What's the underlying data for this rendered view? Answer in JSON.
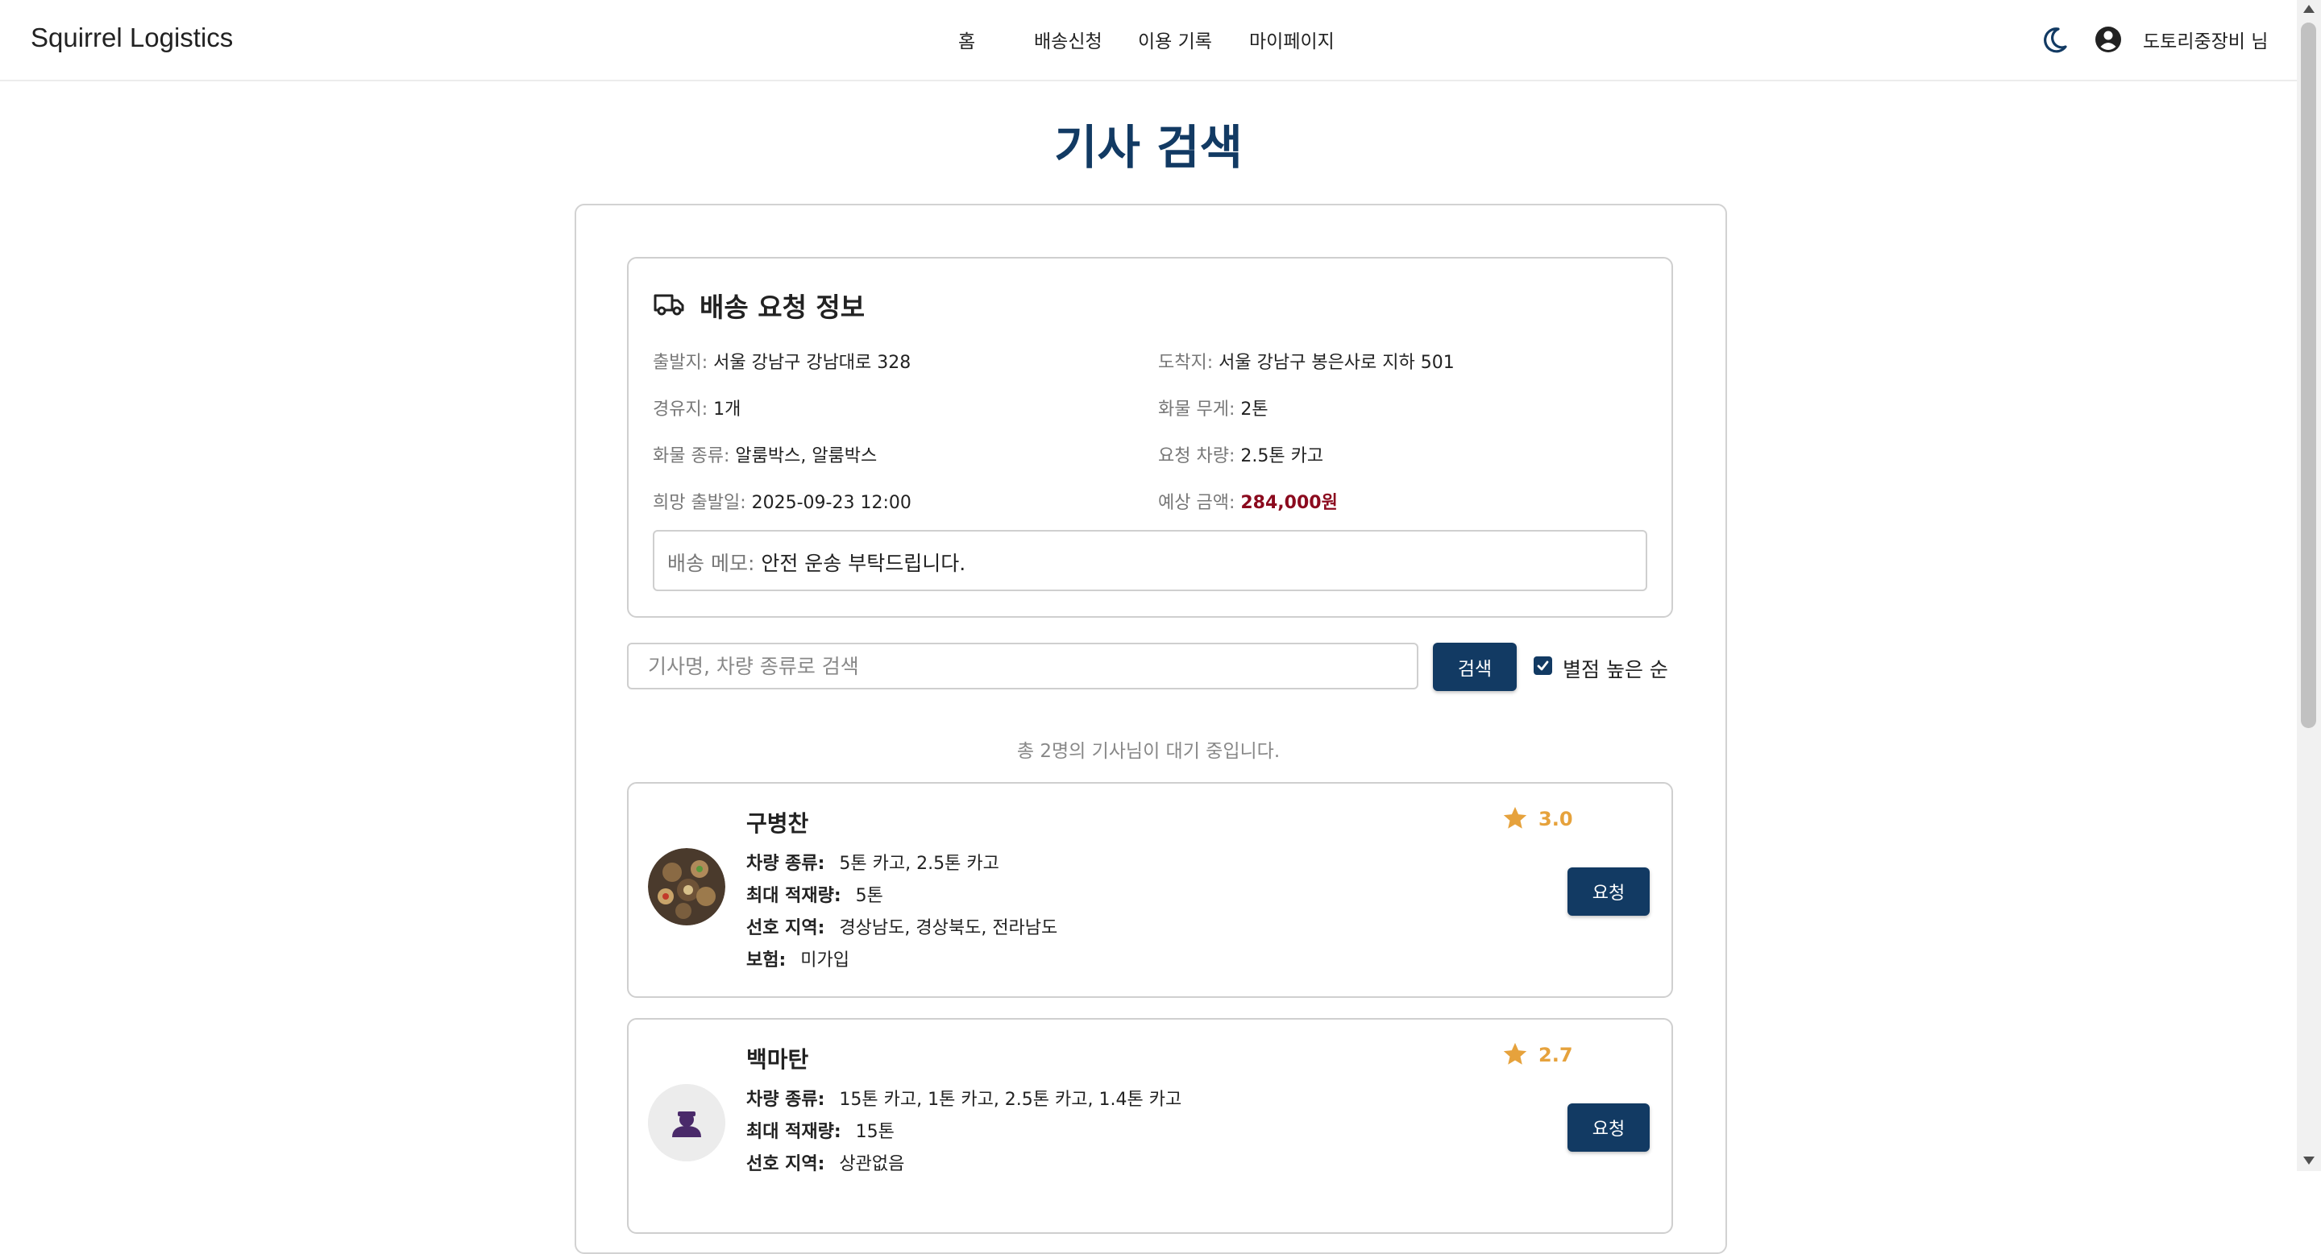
{
  "header": {
    "brand": "Squirrel Logistics",
    "nav": [
      "홈",
      "배송신청",
      "이용 기록",
      "마이페이지"
    ],
    "username": "도토리중장비 님"
  },
  "page": {
    "title": "기사 검색"
  },
  "delivery_info": {
    "title": "배송 요청 정보",
    "origin_label": "출발지:",
    "origin": "서울 강남구 강남대로 328",
    "destination_label": "도착지:",
    "destination": "서울 강남구 봉은사로 지하 501",
    "waypoints_label": "경유지:",
    "waypoints": "1개",
    "weight_label": "화물 무게:",
    "weight": "2톤",
    "cargo_label": "화물 종류:",
    "cargo": "알룸박스, 알룸박스",
    "vehicle_label": "요청 차량:",
    "vehicle": "2.5톤 카고",
    "date_label": "희망 출발일:",
    "date": "2025-09-23 12:00",
    "price_label": "예상 금액:",
    "price": "284,000원",
    "memo_label": "배송 메모:",
    "memo": "안전 운송 부탁드립니다."
  },
  "search": {
    "placeholder": "기사명, 차량 종류로 검색",
    "button": "검색",
    "sort_label": "별점 높은 순",
    "sort_checked": true
  },
  "result_count": "총 2명의 기사님이 대기 중입니다.",
  "drivers": [
    {
      "name": "구병찬",
      "rating": "3.0",
      "vehicle_label": "차량 종류:",
      "vehicle": "5톤 카고, 2.5톤 카고",
      "capacity_label": "최대 적재량:",
      "capacity": "5톤",
      "region_label": "선호 지역:",
      "region": "경상남도, 경상북도, 전라남도",
      "insurance_label": "보험:",
      "insurance": "미가입",
      "button": "요청"
    },
    {
      "name": "백마탄",
      "rating": "2.7",
      "vehicle_label": "차량 종류:",
      "vehicle": "15톤 카고, 1톤 카고, 2.5톤 카고, 1.4톤 카고",
      "capacity_label": "최대 적재량:",
      "capacity": "15톤",
      "region_label": "선호 지역:",
      "region": "상관없음",
      "button": "요청"
    }
  ],
  "colors": {
    "primary": "#123a63",
    "price": "#8b0a1e",
    "star": "#e6a23c"
  }
}
